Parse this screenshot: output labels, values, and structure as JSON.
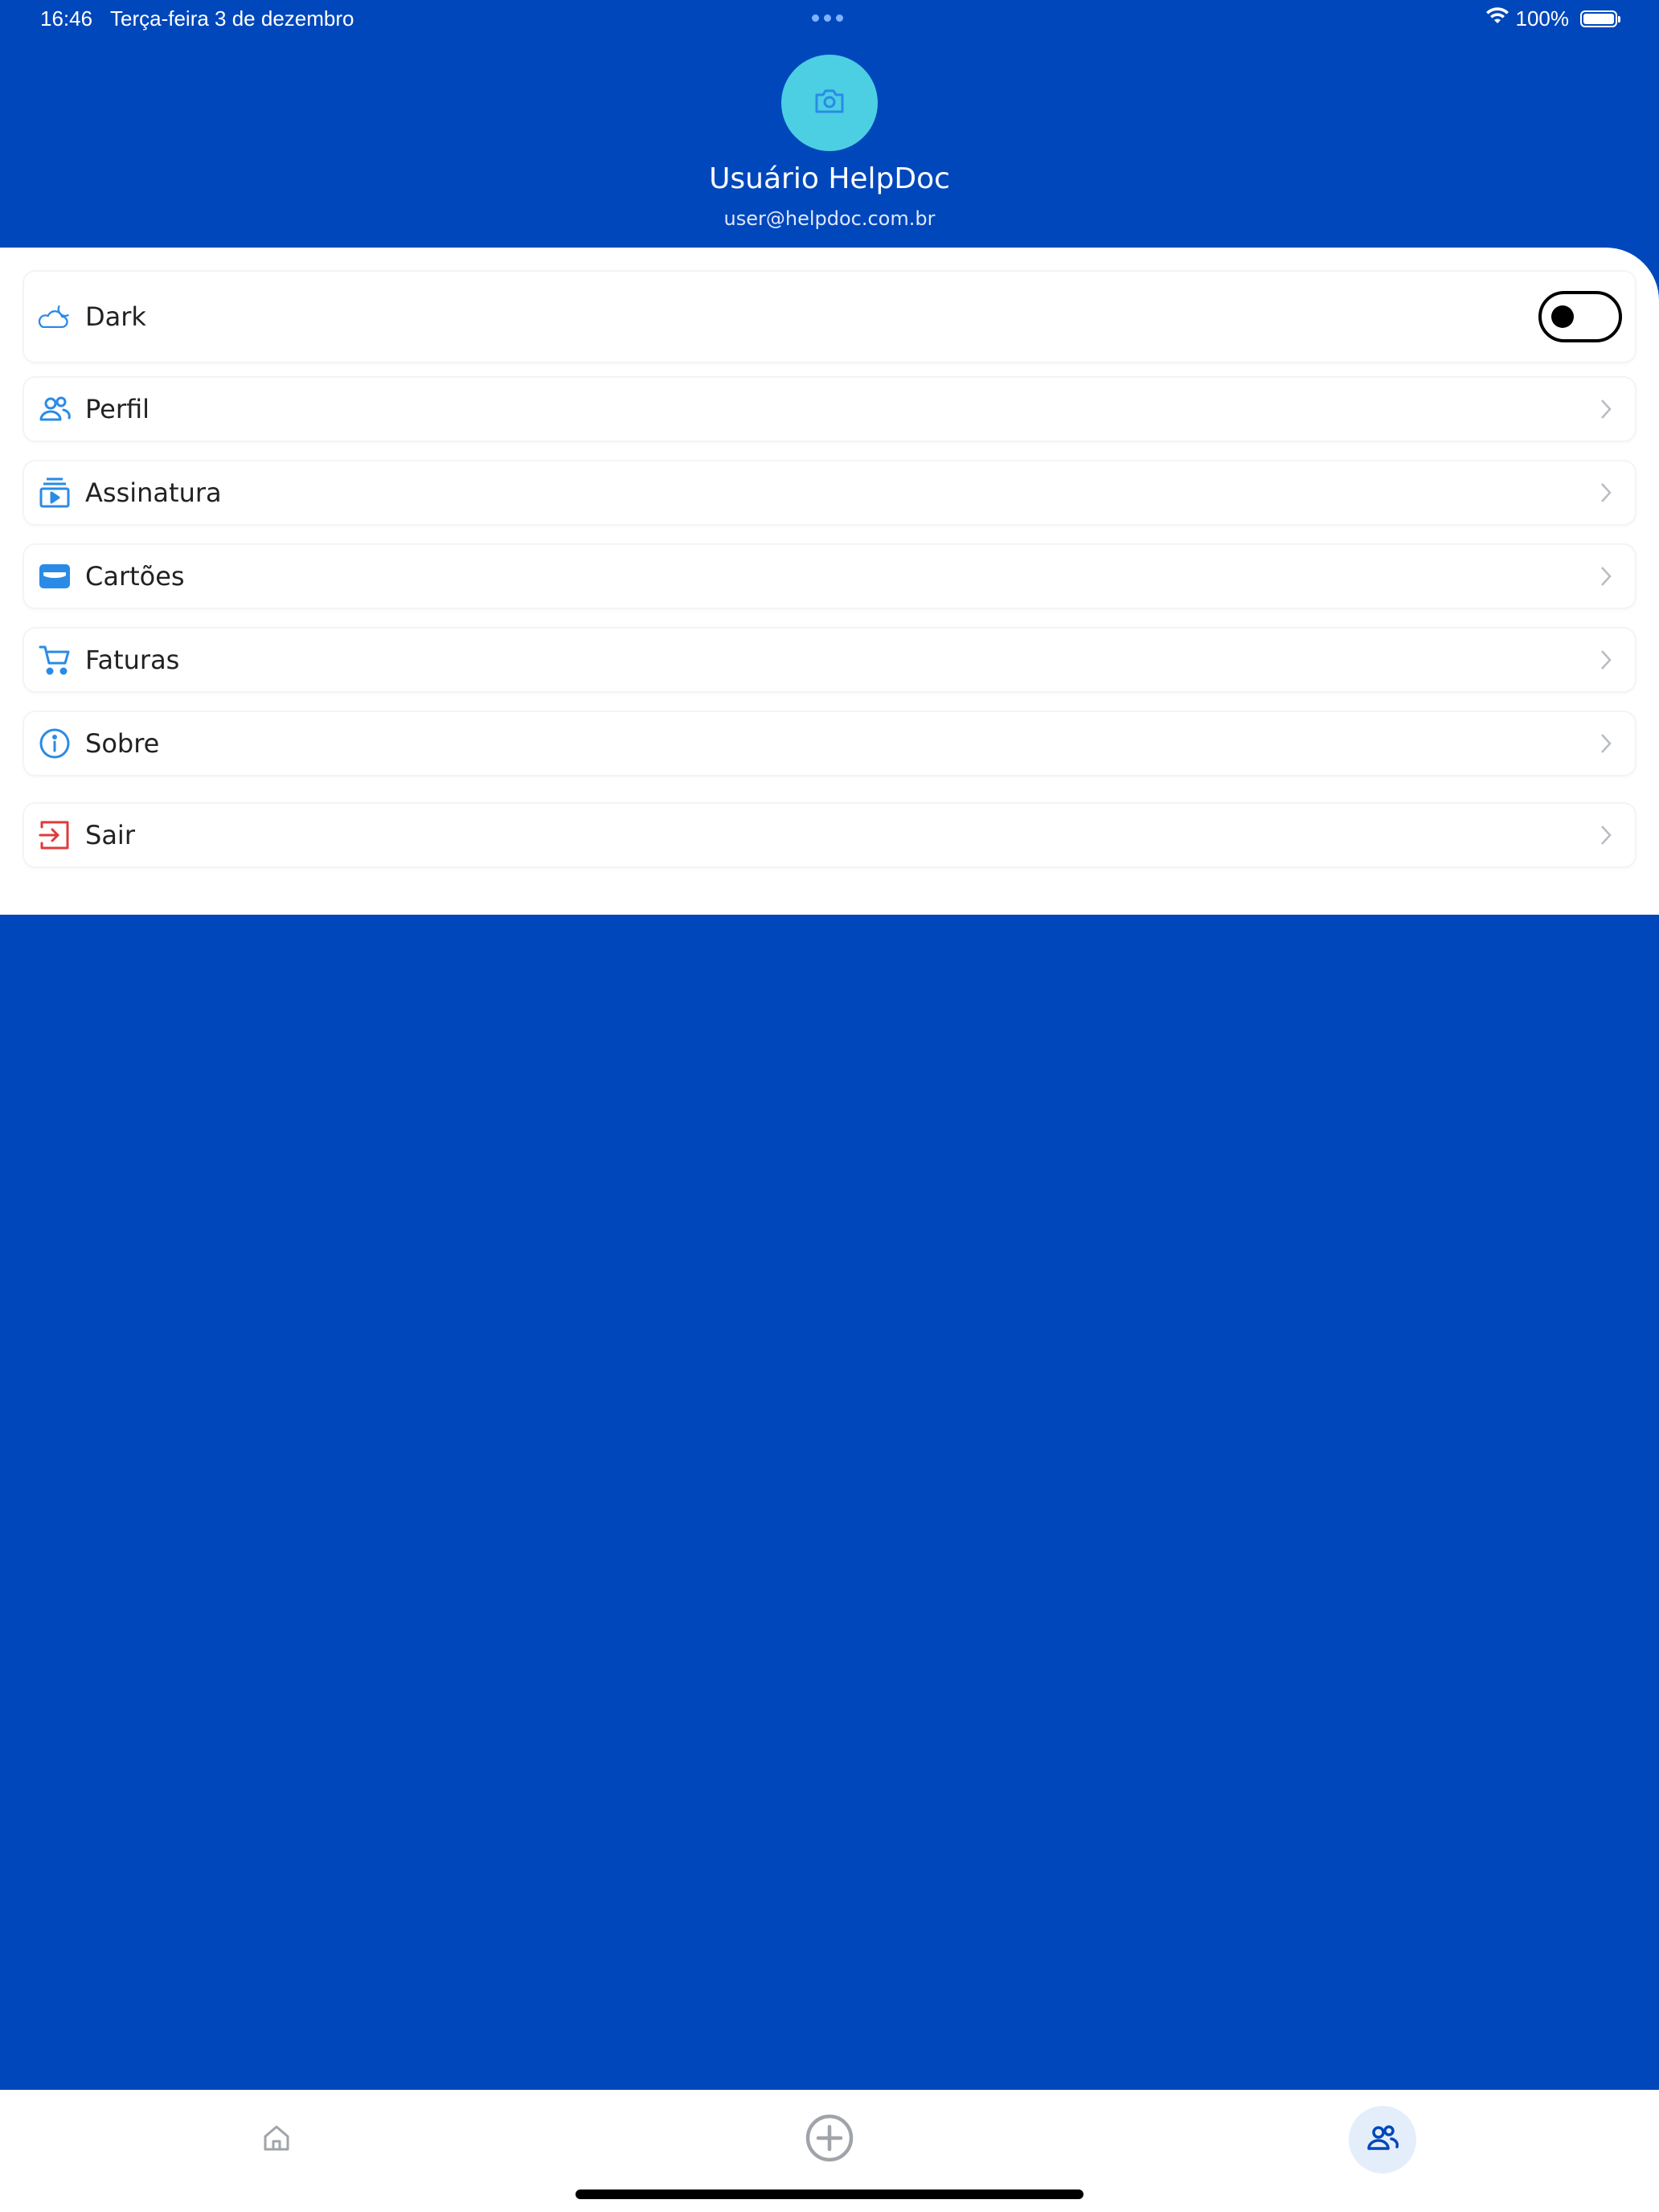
{
  "status_bar": {
    "time": "16:46",
    "date": "Terça-feira 3 de dezembro",
    "battery": "100%",
    "wifi_icon": "wifi-icon"
  },
  "profile": {
    "name": "Usuário HelpDoc",
    "email": "user@helpdoc.com.br",
    "avatar_icon": "camera-icon",
    "avatar_color": "#4ccfe3"
  },
  "menu": {
    "dark_mode": {
      "label": "Dark",
      "icon": "cloud-moon-icon",
      "enabled": false
    },
    "items": [
      {
        "label": "Perfil",
        "icon": "users-icon"
      },
      {
        "label": "Assinatura",
        "icon": "subscription-icon"
      },
      {
        "label": "Cartões",
        "icon": "card-icon"
      },
      {
        "label": "Faturas",
        "icon": "cart-icon"
      },
      {
        "label": "Sobre",
        "icon": "info-icon"
      },
      {
        "label": "Sair",
        "icon": "logout-icon"
      }
    ]
  },
  "tab_bar": {
    "tabs": [
      {
        "name": "home",
        "icon": "home-icon",
        "active": false
      },
      {
        "name": "add",
        "icon": "plus-circle-icon",
        "active": false
      },
      {
        "name": "profile",
        "icon": "users-icon",
        "active": true
      }
    ]
  },
  "colors": {
    "primary": "#0047bb",
    "icon_blue": "#2a8be6",
    "logout_red": "#e03a3a",
    "panel": "#ffffff"
  }
}
